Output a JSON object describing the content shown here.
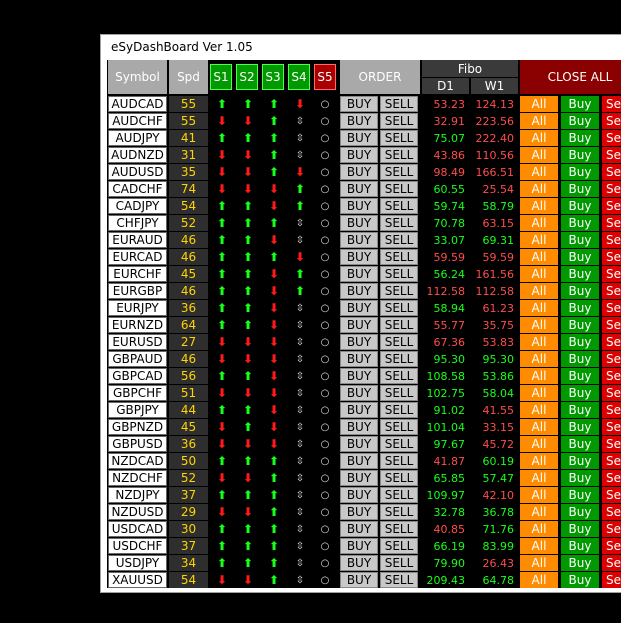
{
  "window": {
    "title": "eSyDashBoard Ver 1.05"
  },
  "header": {
    "symbol": "Symbol",
    "spd": "Spd",
    "s1": "S1",
    "s2": "S2",
    "s3": "S3",
    "s4": "S4",
    "s5": "S5",
    "order": "ORDER",
    "fibo": "Fibo",
    "d1": "D1",
    "w1": "W1",
    "close_all": "CLOSE ALL"
  },
  "labels": {
    "buy": "BUY",
    "sell": "SELL",
    "all": "All",
    "cbuy": "Buy",
    "csell": "Se"
  },
  "arrow_glyphs": {
    "up": "⬆",
    "dn": "⬇",
    "nt": "⇳",
    "circle": "○"
  },
  "rows": [
    {
      "symbol": "AUDCAD",
      "spd": "55",
      "s": [
        "up",
        "up",
        "up",
        "dn"
      ],
      "d1": "53.23",
      "d1_color": "neg",
      "w1": "124.13",
      "w1_color": "neg"
    },
    {
      "symbol": "AUDCHF",
      "spd": "55",
      "s": [
        "dn",
        "dn",
        "up",
        "nt"
      ],
      "d1": "32.91",
      "d1_color": "neg",
      "w1": "223.56",
      "w1_color": "neg"
    },
    {
      "symbol": "AUDJPY",
      "spd": "41",
      "s": [
        "up",
        "up",
        "up",
        "nt"
      ],
      "d1": "75.07",
      "d1_color": "pos",
      "w1": "222.40",
      "w1_color": "neg"
    },
    {
      "symbol": "AUDNZD",
      "spd": "31",
      "s": [
        "dn",
        "dn",
        "up",
        "nt"
      ],
      "d1": "43.86",
      "d1_color": "neg",
      "w1": "110.56",
      "w1_color": "neg"
    },
    {
      "symbol": "AUDUSD",
      "spd": "35",
      "s": [
        "dn",
        "dn",
        "up",
        "dn"
      ],
      "d1": "98.49",
      "d1_color": "neg",
      "w1": "166.51",
      "w1_color": "neg"
    },
    {
      "symbol": "CADCHF",
      "spd": "74",
      "s": [
        "dn",
        "dn",
        "dn",
        "up"
      ],
      "d1": "60.55",
      "d1_color": "pos",
      "w1": "25.54",
      "w1_color": "neg"
    },
    {
      "symbol": "CADJPY",
      "spd": "54",
      "s": [
        "up",
        "up",
        "dn",
        "up"
      ],
      "d1": "59.74",
      "d1_color": "pos",
      "w1": "58.79",
      "w1_color": "pos"
    },
    {
      "symbol": "CHFJPY",
      "spd": "52",
      "s": [
        "up",
        "up",
        "up",
        "nt"
      ],
      "d1": "70.78",
      "d1_color": "pos",
      "w1": "63.15",
      "w1_color": "neg"
    },
    {
      "symbol": "EURAUD",
      "spd": "46",
      "s": [
        "up",
        "up",
        "dn",
        "nt"
      ],
      "d1": "33.07",
      "d1_color": "pos",
      "w1": "69.31",
      "w1_color": "pos"
    },
    {
      "symbol": "EURCAD",
      "spd": "46",
      "s": [
        "up",
        "up",
        "up",
        "dn"
      ],
      "d1": "59.59",
      "d1_color": "neg",
      "w1": "59.59",
      "w1_color": "neg"
    },
    {
      "symbol": "EURCHF",
      "spd": "45",
      "s": [
        "up",
        "up",
        "dn",
        "up"
      ],
      "d1": "56.24",
      "d1_color": "pos",
      "w1": "161.56",
      "w1_color": "neg"
    },
    {
      "symbol": "EURGBP",
      "spd": "46",
      "s": [
        "up",
        "up",
        "dn",
        "up"
      ],
      "d1": "112.58",
      "d1_color": "neg",
      "w1": "112.58",
      "w1_color": "neg"
    },
    {
      "symbol": "EURJPY",
      "spd": "36",
      "s": [
        "up",
        "up",
        "dn",
        "nt"
      ],
      "d1": "58.94",
      "d1_color": "pos",
      "w1": "61.23",
      "w1_color": "neg"
    },
    {
      "symbol": "EURNZD",
      "spd": "64",
      "s": [
        "up",
        "up",
        "dn",
        "nt"
      ],
      "d1": "55.77",
      "d1_color": "neg",
      "w1": "35.75",
      "w1_color": "neg"
    },
    {
      "symbol": "EURUSD",
      "spd": "27",
      "s": [
        "dn",
        "dn",
        "dn",
        "nt"
      ],
      "d1": "67.36",
      "d1_color": "neg",
      "w1": "53.83",
      "w1_color": "neg"
    },
    {
      "symbol": "GBPAUD",
      "spd": "46",
      "s": [
        "dn",
        "dn",
        "dn",
        "nt"
      ],
      "d1": "95.30",
      "d1_color": "pos",
      "w1": "95.30",
      "w1_color": "pos"
    },
    {
      "symbol": "GBPCAD",
      "spd": "56",
      "s": [
        "up",
        "up",
        "dn",
        "nt"
      ],
      "d1": "108.58",
      "d1_color": "pos",
      "w1": "53.86",
      "w1_color": "pos"
    },
    {
      "symbol": "GBPCHF",
      "spd": "51",
      "s": [
        "dn",
        "dn",
        "dn",
        "nt"
      ],
      "d1": "102.75",
      "d1_color": "pos",
      "w1": "58.04",
      "w1_color": "pos"
    },
    {
      "symbol": "GBPJPY",
      "spd": "44",
      "s": [
        "up",
        "up",
        "dn",
        "nt"
      ],
      "d1": "91.02",
      "d1_color": "pos",
      "w1": "41.55",
      "w1_color": "neg"
    },
    {
      "symbol": "GBPNZD",
      "spd": "45",
      "s": [
        "dn",
        "up",
        "dn",
        "nt"
      ],
      "d1": "101.04",
      "d1_color": "pos",
      "w1": "33.15",
      "w1_color": "neg"
    },
    {
      "symbol": "GBPUSD",
      "spd": "36",
      "s": [
        "dn",
        "dn",
        "dn",
        "nt"
      ],
      "d1": "97.67",
      "d1_color": "pos",
      "w1": "45.72",
      "w1_color": "neg"
    },
    {
      "symbol": "NZDCAD",
      "spd": "50",
      "s": [
        "up",
        "up",
        "up",
        "nt"
      ],
      "d1": "41.87",
      "d1_color": "neg",
      "w1": "60.19",
      "w1_color": "pos"
    },
    {
      "symbol": "NZDCHF",
      "spd": "52",
      "s": [
        "dn",
        "dn",
        "up",
        "nt"
      ],
      "d1": "65.85",
      "d1_color": "pos",
      "w1": "57.47",
      "w1_color": "pos"
    },
    {
      "symbol": "NZDJPY",
      "spd": "37",
      "s": [
        "up",
        "up",
        "up",
        "nt"
      ],
      "d1": "109.97",
      "d1_color": "pos",
      "w1": "42.10",
      "w1_color": "neg"
    },
    {
      "symbol": "NZDUSD",
      "spd": "29",
      "s": [
        "dn",
        "dn",
        "up",
        "nt"
      ],
      "d1": "32.78",
      "d1_color": "pos",
      "w1": "36.78",
      "w1_color": "pos"
    },
    {
      "symbol": "USDCAD",
      "spd": "30",
      "s": [
        "up",
        "up",
        "up",
        "nt"
      ],
      "d1": "40.85",
      "d1_color": "neg",
      "w1": "71.76",
      "w1_color": "pos"
    },
    {
      "symbol": "USDCHF",
      "spd": "37",
      "s": [
        "up",
        "up",
        "up",
        "nt"
      ],
      "d1": "66.19",
      "d1_color": "pos",
      "w1": "83.99",
      "w1_color": "pos"
    },
    {
      "symbol": "USDJPY",
      "spd": "34",
      "s": [
        "up",
        "up",
        "up",
        "nt"
      ],
      "d1": "79.90",
      "d1_color": "pos",
      "w1": "26.43",
      "w1_color": "neg"
    },
    {
      "symbol": "XAUUSD",
      "spd": "54",
      "s": [
        "dn",
        "dn",
        "up",
        "nt"
      ],
      "d1": "209.43",
      "d1_color": "pos",
      "w1": "64.78",
      "w1_color": "pos"
    }
  ]
}
